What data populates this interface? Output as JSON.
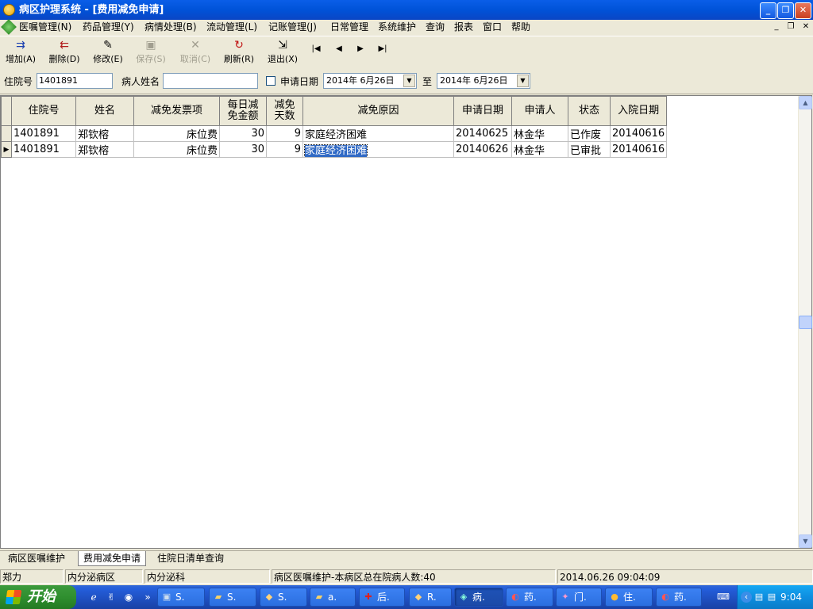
{
  "window": {
    "title": "病区护理系统 - [费用减免申请]"
  },
  "menu": [
    {
      "label": "医嘱管理(N)"
    },
    {
      "label": "药品管理(Y)"
    },
    {
      "label": "病情处理(B)"
    },
    {
      "label": "流动管理(L)"
    },
    {
      "label": "记账管理(J)"
    },
    {
      "label": "日常管理"
    },
    {
      "label": "系统维护"
    },
    {
      "label": "查询"
    },
    {
      "label": "报表"
    },
    {
      "label": "窗口"
    },
    {
      "label": "帮助"
    }
  ],
  "toolbar": {
    "add": "增加(A)",
    "delete": "删除(D)",
    "edit": "修改(E)",
    "save": "保存(S)",
    "cancel": "取消(C)",
    "refresh": "刷新(R)",
    "exit": "退出(X)"
  },
  "filter": {
    "admission_no_label": "住院号",
    "admission_no_value": "1401891",
    "patient_name_label": "病人姓名",
    "patient_name_value": "",
    "apply_date_label": "申请日期",
    "apply_date_checked": false,
    "date_from": "2014年 6月26日",
    "to_label": "至",
    "date_to": "2014年 6月26日"
  },
  "grid": {
    "columns": [
      "住院号",
      "姓名",
      "减免发票项",
      "每日减\n免金额",
      "减免\n天数",
      "减免原因",
      "申请日期",
      "申请人",
      "状态",
      "入院日期"
    ],
    "rows": [
      [
        "1401891",
        "郑钦榕",
        "床位费",
        "30",
        "9",
        "家庭经济困难",
        "20140625",
        "林金华",
        "已作废",
        "20140616"
      ],
      [
        "1401891",
        "郑钦榕",
        "床位费",
        "30",
        "9",
        "家庭经济困难",
        "20140626",
        "林金华",
        "已审批",
        "20140616"
      ]
    ],
    "current_row": 1
  },
  "tabs": [
    {
      "label": "病区医嘱维护"
    },
    {
      "label": "费用减免申请"
    },
    {
      "label": "住院日清单查询"
    }
  ],
  "status": {
    "user": "郑力",
    "ward": "内分泌病区",
    "dept": "内分泌科",
    "message": "病区医嘱维护-本病区总在院病人数:40",
    "datetime": "2014.06.26 09:04:09"
  },
  "taskbar": {
    "start_label": "开始",
    "tasks": [
      {
        "label": "S.",
        "icon": "terminal-icon"
      },
      {
        "label": "S.",
        "icon": "folder-icon"
      },
      {
        "label": "S.",
        "icon": "app-icon"
      },
      {
        "label": "a.",
        "icon": "folder-icon"
      },
      {
        "label": "后.",
        "icon": "red-cross-icon"
      },
      {
        "label": "R.",
        "icon": "app-icon"
      },
      {
        "label": "病.",
        "icon": "ward-icon"
      },
      {
        "label": "药.",
        "icon": "pill-icon"
      },
      {
        "label": "门.",
        "icon": "clinic-icon"
      },
      {
        "label": "住.",
        "icon": "inpatient-icon"
      },
      {
        "label": "药.",
        "icon": "pill-icon"
      }
    ],
    "clock": "9:04"
  }
}
